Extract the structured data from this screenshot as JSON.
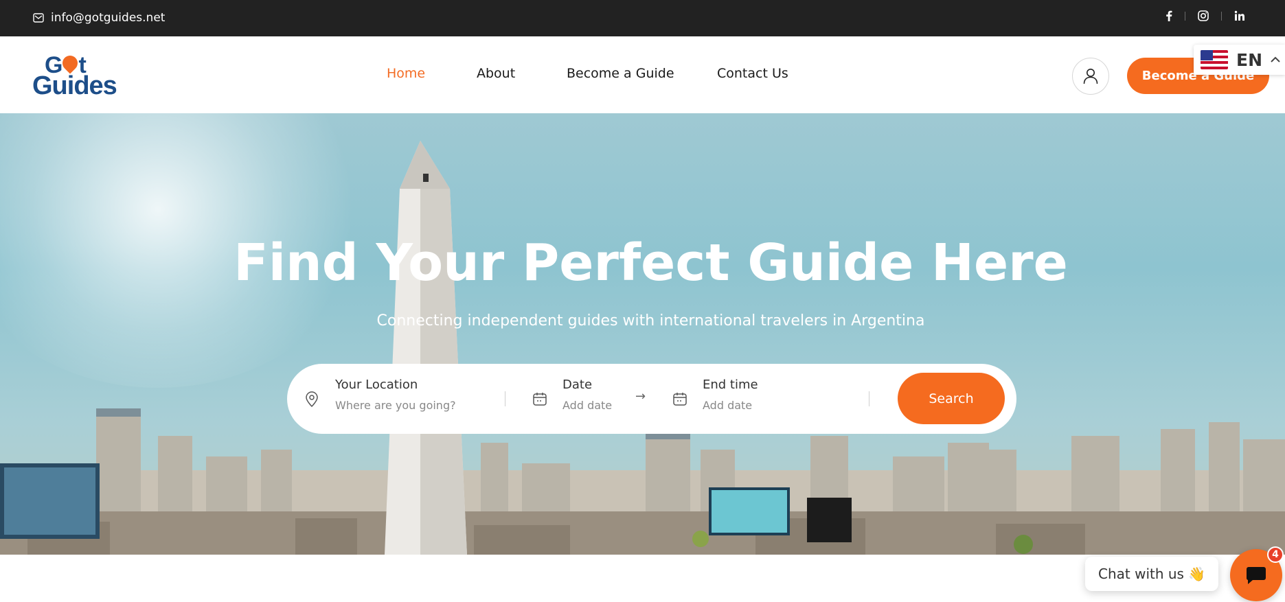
{
  "topbar": {
    "email": "info@gotguides.net",
    "socials": [
      "facebook-icon",
      "instagram-icon",
      "linkedin-icon"
    ]
  },
  "header": {
    "logo_line1": "Got",
    "logo_line2": "Guides",
    "nav": [
      {
        "label": "Home",
        "active": true
      },
      {
        "label": "About",
        "active": false
      },
      {
        "label": "Become a Guide",
        "active": false
      },
      {
        "label": "Contact Us",
        "active": false
      }
    ],
    "cta_label": "Become a Guide",
    "language": "EN"
  },
  "hero": {
    "title": "Find Your Perfect Guide Here",
    "subtitle": "Connecting independent guides with international travelers in Argentina"
  },
  "search": {
    "location_label": "Your Location",
    "location_placeholder": "Where are you going?",
    "date_label": "Date",
    "date_placeholder": "Add date",
    "end_label": "End time",
    "end_placeholder": "Add date",
    "button": "Search"
  },
  "chat": {
    "prompt": "Chat with us 👋",
    "badge_count": "4"
  },
  "colors": {
    "accent": "#f56b1f",
    "topbar": "#222222",
    "logo_blue": "#1d4e89"
  }
}
